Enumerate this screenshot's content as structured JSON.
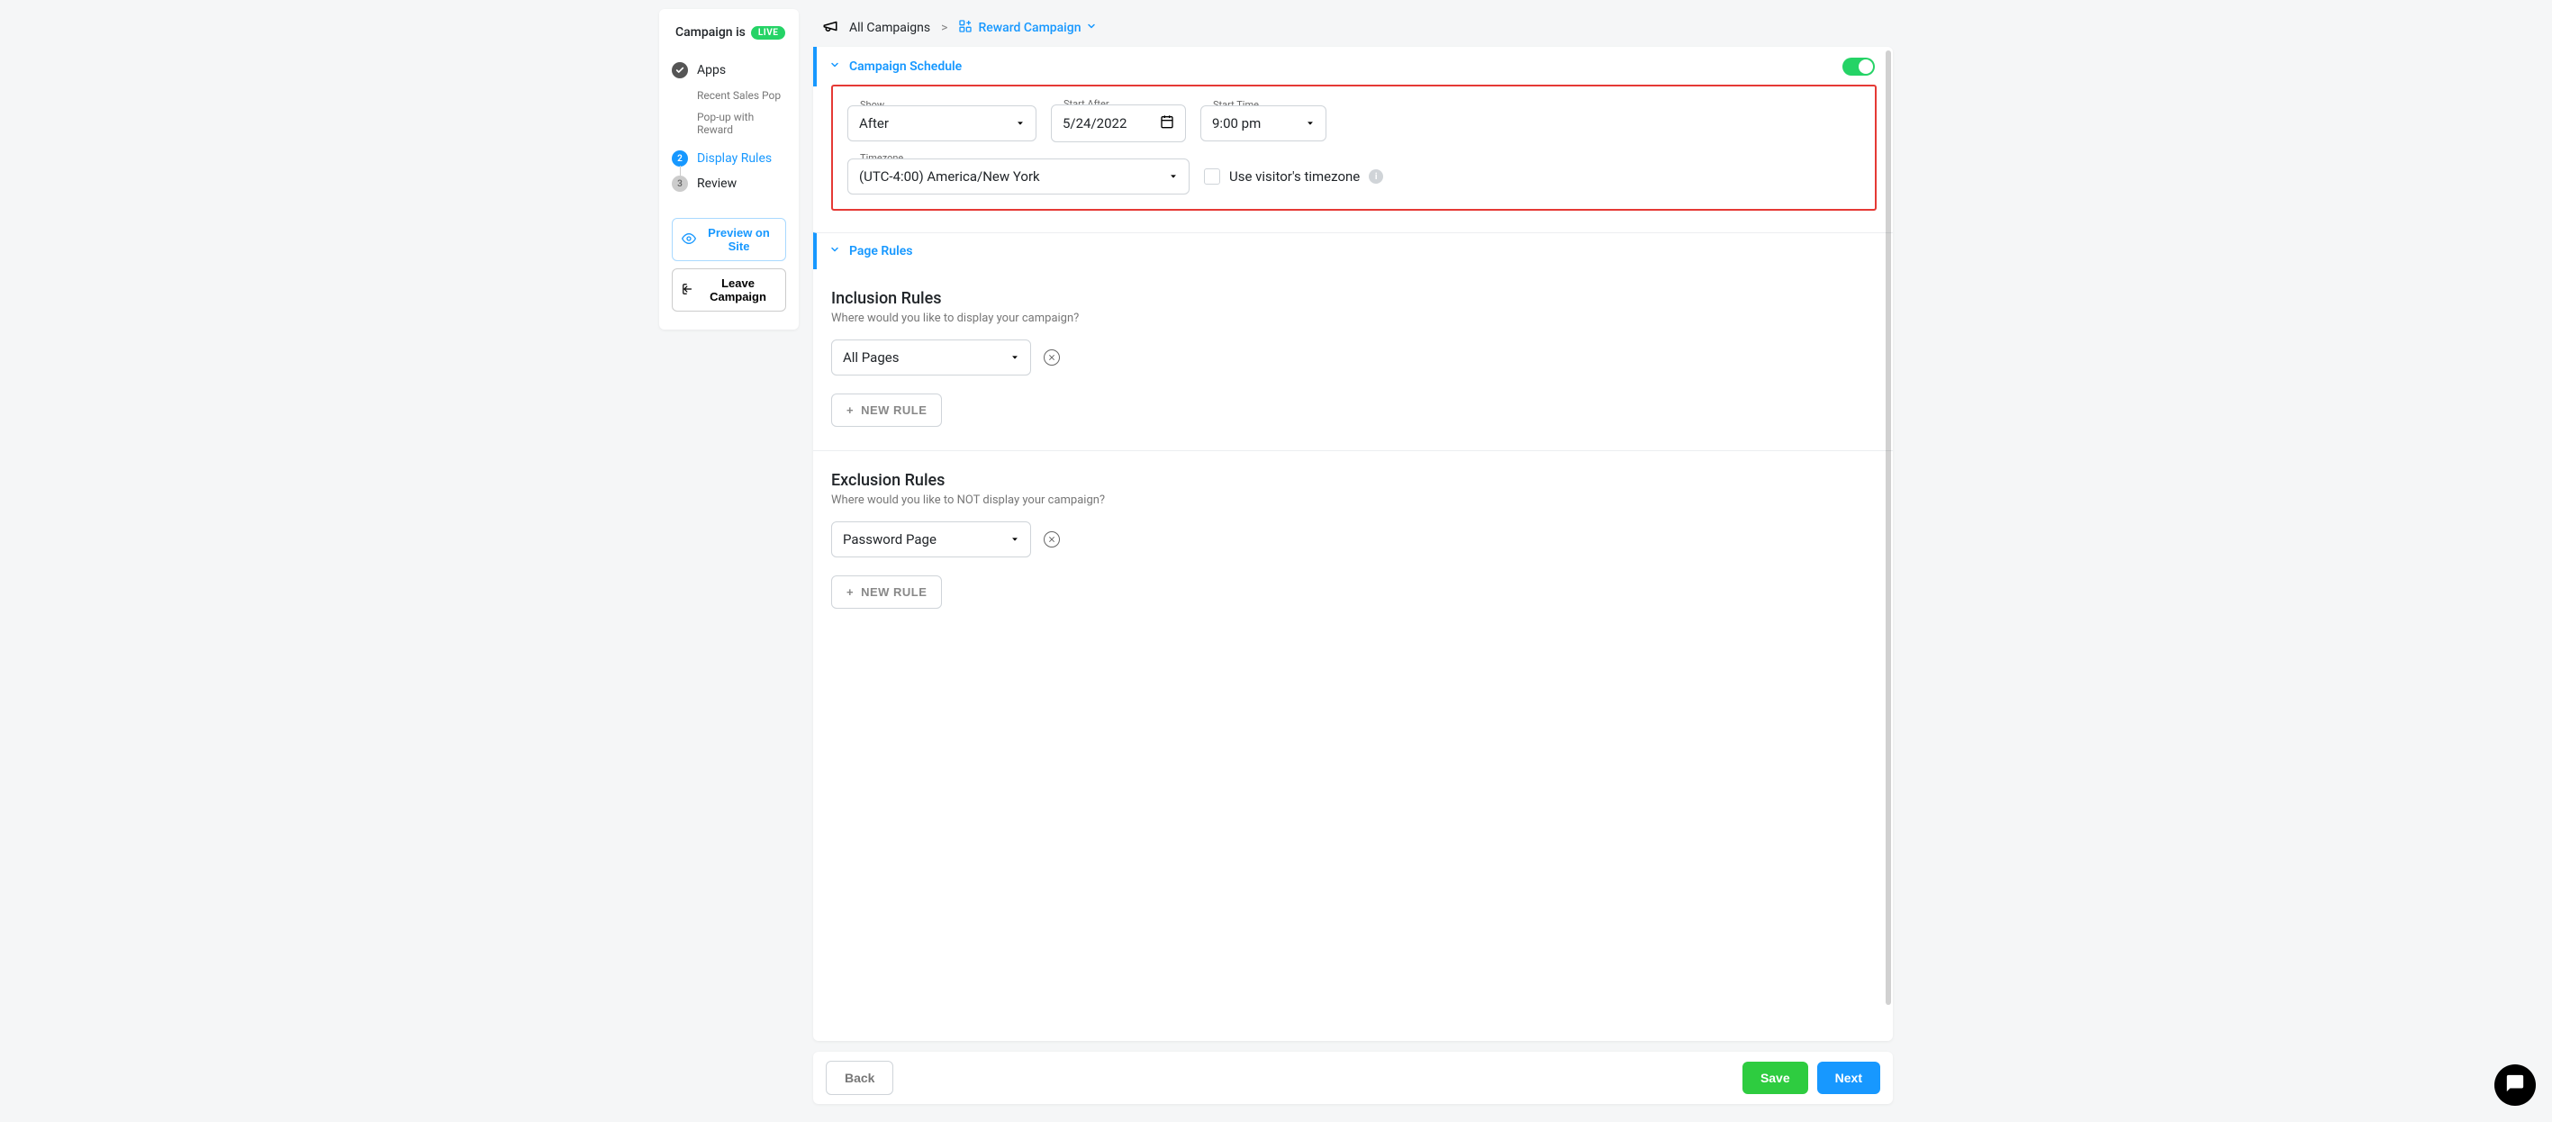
{
  "sidebar": {
    "status_prefix": "Campaign is",
    "status_badge": "LIVE",
    "steps": {
      "apps": {
        "label": "Apps"
      },
      "apps_sub": [
        "Recent Sales Pop",
        "Pop-up with Reward"
      ],
      "display_rules": {
        "num": "2",
        "label": "Display Rules"
      },
      "review": {
        "num": "3",
        "label": "Review"
      }
    },
    "preview_label": "Preview on Site",
    "leave_label": "Leave Campaign"
  },
  "breadcrumb": {
    "root": "All Campaigns",
    "sep": ">",
    "current": "Reward Campaign"
  },
  "schedule": {
    "title": "Campaign Schedule",
    "show_label": "Show",
    "show_value": "After",
    "start_after_label": "Start After",
    "start_after_value": "5/24/2022",
    "start_time_label": "Start Time",
    "start_time_value": "9:00 pm",
    "timezone_label": "Timezone",
    "timezone_value": "(UTC-4:00) America/New York",
    "use_visitor_tz_label": "Use visitor's timezone"
  },
  "page_rules": {
    "title": "Page Rules",
    "inclusion": {
      "title": "Inclusion Rules",
      "sub": "Where would you like to display your campaign?",
      "value": "All Pages",
      "new_rule": "NEW RULE"
    },
    "exclusion": {
      "title": "Exclusion Rules",
      "sub": "Where would you like to NOT display your campaign?",
      "value": "Password Page",
      "new_rule": "NEW RULE"
    }
  },
  "footer": {
    "back": "Back",
    "save": "Save",
    "next": "Next"
  }
}
